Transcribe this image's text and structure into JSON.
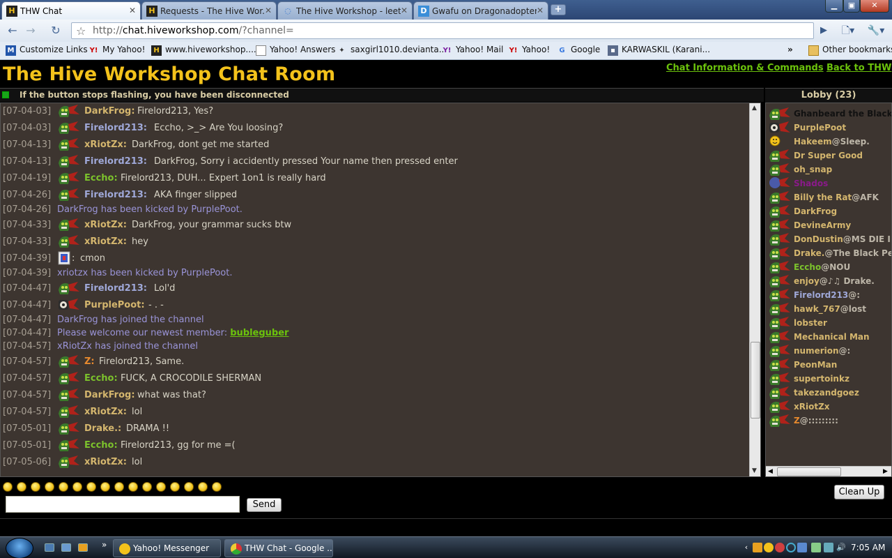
{
  "browser": {
    "tabs": [
      {
        "title": "THW Chat",
        "icon": "hive-icon",
        "active": true
      },
      {
        "title": "Requests - The Hive Wor...",
        "icon": "hive-icon",
        "active": false
      },
      {
        "title": "The Hive Workshop - leet...",
        "icon": "loading-icon",
        "active": false
      },
      {
        "title": "Gwafu on Dragonadopters",
        "icon": "d-icon",
        "active": false
      }
    ],
    "new_tab": "+",
    "url_prefix": "http://",
    "url_host": "chat.hiveworkshop.com",
    "url_path": "/?channel=",
    "bookmarks": [
      {
        "label": "Customize Links"
      },
      {
        "label": "My Yahoo!"
      },
      {
        "label": "www.hiveworkshop...."
      },
      {
        "label": "Yahoo! Answers"
      },
      {
        "label": "saxgirl1010.devianta..."
      },
      {
        "label": "Yahoo! Mail"
      },
      {
        "label": "Yahoo!"
      },
      {
        "label": "Google"
      },
      {
        "label": "KARWASKIL (Karani..."
      }
    ],
    "bookmarks_overflow": "»",
    "other_bookmarks": "Other bookmarks"
  },
  "page": {
    "title": "The Hive Workshop Chat Room",
    "links": {
      "info": "Chat Information & Commands",
      "back": "Back to THW"
    },
    "status_text": "If the button stops flashing, you have been disconnected",
    "lobby_title": "Lobby (23)",
    "send_label": "Send",
    "clean_label": "Clean Up",
    "input_value": ""
  },
  "messages": [
    {
      "ts": "[07-04-03]",
      "name": "DarkFrog:",
      "text": "Firelord213, Yes?",
      "color": "#d4b66e"
    },
    {
      "ts": "[07-04-03]",
      "name": "Firelord213:",
      "text": "Eccho, >_> Are You loosing?",
      "color": "#9fa8d8"
    },
    {
      "ts": "[07-04-13]",
      "name": "xRiotZx:",
      "text": "DarkFrog, dont get me started",
      "color": "#d4b66e"
    },
    {
      "ts": "[07-04-13]",
      "name": "Firelord213:",
      "text": "DarkFrog, Sorry i accidently pressed Your name then pressed enter",
      "color": "#9fa8d8"
    },
    {
      "ts": "[07-04-19]",
      "name": "Eccho:",
      "text": "Firelord213, DUH... Expert 1on1 is really hard",
      "color": "#7cc22c"
    },
    {
      "ts": "[07-04-26]",
      "name": "Firelord213:",
      "text": "AKA finger slipped",
      "color": "#9fa8d8"
    },
    {
      "ts": "[07-04-26]",
      "system": "DarkFrog has been kicked by PurplePoot."
    },
    {
      "ts": "[07-04-33]",
      "name": "xRiotZx:",
      "text": "DarkFrog, your grammar sucks btw",
      "color": "#d4b66e"
    },
    {
      "ts": "[07-04-33]",
      "name": "xRiotZx:",
      "text": "hey",
      "color": "#d4b66e"
    },
    {
      "ts": "[07-04-39]",
      "name": ":",
      "text": "cmon",
      "color": "#d8d4c6",
      "noname": true
    },
    {
      "ts": "[07-04-39]",
      "system": "xriotzx has been kicked by PurplePoot."
    },
    {
      "ts": "[07-04-47]",
      "name": "Firelord213:",
      "text": "Lol'd",
      "color": "#9fa8d8"
    },
    {
      "ts": "[07-04-47]",
      "name": "PurplePoot:",
      "text": "- . -",
      "color": "#d4b66e"
    },
    {
      "ts": "[07-04-47]",
      "system": "DarkFrog has joined the channel"
    },
    {
      "ts": "[07-04-47]",
      "system": "Please welcome our newest member:",
      "link": "bubleguber"
    },
    {
      "ts": "[07-04-57]",
      "system": "xRiotZx has joined the channel"
    },
    {
      "ts": "[07-04-57]",
      "name": "Z:",
      "text": "Firelord213, Same.",
      "color": "#e88a2e"
    },
    {
      "ts": "[07-04-57]",
      "name": "Eccho:",
      "text": "FUCK, A CROCODILE SHERMAN",
      "color": "#7cc22c"
    },
    {
      "ts": "[07-04-57]",
      "name": "DarkFrog:",
      "text": "what was that?",
      "color": "#d4b66e"
    },
    {
      "ts": "[07-04-57]",
      "name": "xRiotZx:",
      "text": "lol",
      "color": "#d4b66e"
    },
    {
      "ts": "[07-05-01]",
      "name": "Drake.:",
      "text": "DRAMA !!",
      "color": "#d4b66e"
    },
    {
      "ts": "[07-05-01]",
      "name": "Eccho:",
      "text": "Firelord213, gg for me =(",
      "color": "#7cc22c"
    },
    {
      "ts": "[07-05-06]",
      "name": "xRiotZx:",
      "text": "lol",
      "color": "#d4b66e"
    }
  ],
  "lobby": [
    {
      "name": "Ghanbeard the Black",
      "status": "",
      "color": "#111111"
    },
    {
      "name": "PurplePoot",
      "status": "",
      "color": "#d4b66e"
    },
    {
      "name": "Hakeem",
      "status": "@Sleep.",
      "color": "#d4b66e"
    },
    {
      "name": "Dr Super Good",
      "status": "",
      "color": "#d4b66e"
    },
    {
      "name": "oh_snap",
      "status": "",
      "color": "#d4b66e"
    },
    {
      "name": "Shados",
      "status": "",
      "color": "#8a1a8a"
    },
    {
      "name": "Billy the Rat",
      "status": "@AFK",
      "color": "#d4b66e"
    },
    {
      "name": "DarkFrog",
      "status": "",
      "color": "#d4b66e"
    },
    {
      "name": "DevineArmy",
      "status": "",
      "color": "#d4b66e"
    },
    {
      "name": "DonDustin",
      "status": "@MS DIE IN",
      "color": "#d4b66e"
    },
    {
      "name": "Drake.",
      "status": "@The Black Pe",
      "color": "#d4b66e"
    },
    {
      "name": "Eccho",
      "status": "@NOU",
      "color": "#7cc22c"
    },
    {
      "name": "enjoy",
      "status": "@♪♫ Drake.",
      "color": "#d4b66e"
    },
    {
      "name": "Firelord213",
      "status": "@:",
      "color": "#9fa8d8"
    },
    {
      "name": "hawk_767",
      "status": "@lost",
      "color": "#d4b66e"
    },
    {
      "name": "lobster",
      "status": "",
      "color": "#d4b66e"
    },
    {
      "name": "Mechanical Man",
      "status": "",
      "color": "#d4b66e"
    },
    {
      "name": "numerion",
      "status": "@:",
      "color": "#d4b66e"
    },
    {
      "name": "PeonMan",
      "status": "",
      "color": "#d4b66e"
    },
    {
      "name": "supertoinkz",
      "status": "",
      "color": "#d4b66e"
    },
    {
      "name": "takezandgoez",
      "status": "",
      "color": "#d4b66e"
    },
    {
      "name": "xRiotZx",
      "status": "",
      "color": "#d4b66e"
    },
    {
      "name": "Z",
      "status": "@:::::::::",
      "color": "#e88a2e"
    }
  ],
  "taskbar": {
    "tasks": [
      {
        "label": "Yahoo! Messenger"
      },
      {
        "label": "THW Chat - Google ..."
      }
    ],
    "clock": "7:05 AM"
  }
}
